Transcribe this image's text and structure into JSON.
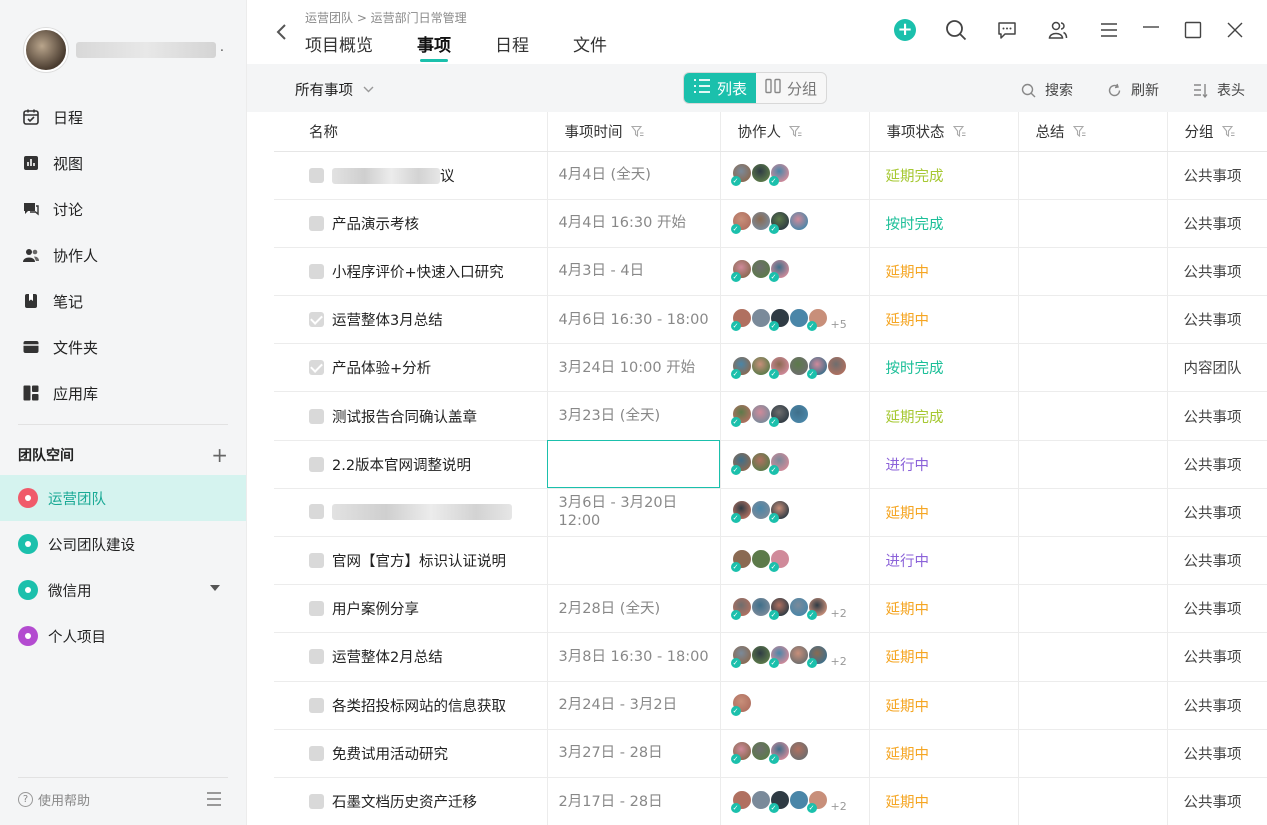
{
  "profile": {
    "name_suffix": "."
  },
  "nav": [
    {
      "label": "日程",
      "icon": "calendar-check-icon"
    },
    {
      "label": "视图",
      "icon": "bar-chart-icon"
    },
    {
      "label": "讨论",
      "icon": "discussion-icon"
    },
    {
      "label": "协作人",
      "icon": "people-icon"
    },
    {
      "label": "笔记",
      "icon": "bookmark-icon"
    },
    {
      "label": "文件夹",
      "icon": "folder-icon"
    },
    {
      "label": "应用库",
      "icon": "app-grid-icon"
    }
  ],
  "team_space": {
    "title": "团队空间",
    "add": "+",
    "teams": [
      {
        "label": "运营团队",
        "color": "#f05a6a",
        "active": true
      },
      {
        "label": "公司团队建设",
        "color": "#1bc0ac"
      },
      {
        "label": "微信用",
        "color": "#1bc0ac",
        "expandable": true
      },
      {
        "label": "个人项目",
        "color": "#b34bd0"
      }
    ]
  },
  "help": {
    "label": "使用帮助"
  },
  "header": {
    "breadcrumb": "运营团队 > 运营部门日常管理",
    "tabs": [
      "项目概览",
      "事项",
      "日程",
      "文件"
    ],
    "active_tab": 1,
    "add": "+"
  },
  "toolbar": {
    "filter": "所有事项",
    "view_list": "列表",
    "view_group": "分组",
    "search": "搜索",
    "refresh": "刷新",
    "columns": "表头"
  },
  "colors": {
    "accent": "#1bc0ac",
    "delayed_done": "#a6c832",
    "on_time": "#1bbf98",
    "delayed": "#f5a623",
    "in_progress": "#8b62d9"
  },
  "table": {
    "columns": [
      "名称",
      "事项时间",
      "协作人",
      "事项状态",
      "总结",
      "分组"
    ],
    "rows": [
      {
        "name": "议",
        "blurred": true,
        "blur_w": 108,
        "checked": false,
        "time": "4月4日 (全天)",
        "avatars": 3,
        "more": "",
        "status": "延期完成",
        "status_key": "delayed_done",
        "summary": "",
        "group": "公共事项"
      },
      {
        "name": "产品演示考核",
        "checked": false,
        "time": "4月4日 16:30 开始",
        "avatars": 4,
        "more": "",
        "status": "按时完成",
        "status_key": "on_time",
        "summary": "",
        "group": "公共事项"
      },
      {
        "name": "小程序评价+快速入口研究",
        "checked": false,
        "time": "4月3日 - 4日",
        "avatars": 3,
        "more": "",
        "status": "延期中",
        "status_key": "delayed",
        "summary": "",
        "group": "公共事项"
      },
      {
        "name": "运营整体3月总结",
        "checked": true,
        "time": "4月6日 16:30 - 18:00",
        "avatars": 5,
        "more": "+5",
        "status": "延期中",
        "status_key": "delayed",
        "summary": "",
        "group": "公共事项"
      },
      {
        "name": "产品体验+分析",
        "checked": true,
        "time": "3月24日 10:00 开始",
        "avatars": 6,
        "more": "",
        "status": "按时完成",
        "status_key": "on_time",
        "summary": "",
        "group": "内容团队"
      },
      {
        "name": "测试报告合同确认盖章",
        "checked": false,
        "time": "3月23日 (全天)",
        "avatars": 4,
        "more": "",
        "status": "延期完成",
        "status_key": "delayed_done",
        "summary": "",
        "group": "公共事项"
      },
      {
        "name": "2.2版本官网调整说明",
        "checked": false,
        "time": "",
        "selected": true,
        "avatars": 3,
        "more": "",
        "status": "进行中",
        "status_key": "in_progress",
        "summary": "",
        "group": "公共事项"
      },
      {
        "name": "",
        "blurred": true,
        "blur_w": 180,
        "checked": false,
        "time": "3月6日 - 3月20日 12:00",
        "avatars": 3,
        "more": "",
        "status": "延期中",
        "status_key": "delayed",
        "summary": "",
        "group": "公共事项"
      },
      {
        "name": "官网【官方】标识认证说明",
        "checked": false,
        "time": "",
        "avatars": 3,
        "more": "",
        "status": "进行中",
        "status_key": "in_progress",
        "summary": "",
        "group": "公共事项"
      },
      {
        "name": "用户案例分享",
        "checked": false,
        "time": "2月28日 (全天)",
        "avatars": 5,
        "more": "+2",
        "status": "延期中",
        "status_key": "delayed",
        "summary": "",
        "group": "公共事项"
      },
      {
        "name": "运营整体2月总结",
        "checked": false,
        "time": "3月8日 16:30 - 18:00",
        "avatars": 5,
        "more": "+2",
        "status": "延期中",
        "status_key": "delayed",
        "summary": "",
        "group": "公共事项"
      },
      {
        "name": "各类招投标网站的信息获取",
        "checked": false,
        "time": "2月24日 - 3月2日",
        "avatars": 1,
        "more": "",
        "status": "延期中",
        "status_key": "delayed",
        "summary": "",
        "group": "公共事项"
      },
      {
        "name": "免费试用活动研究",
        "checked": false,
        "time": "3月27日 - 28日",
        "avatars": 4,
        "more": "",
        "status": "延期中",
        "status_key": "delayed",
        "summary": "",
        "group": "公共事项"
      },
      {
        "name": "石墨文档历史资产迁移",
        "checked": false,
        "time": "2月17日 - 28日",
        "avatars": 5,
        "more": "+2",
        "status": "延期中",
        "status_key": "delayed",
        "summary": "",
        "group": "公共事项"
      }
    ]
  }
}
